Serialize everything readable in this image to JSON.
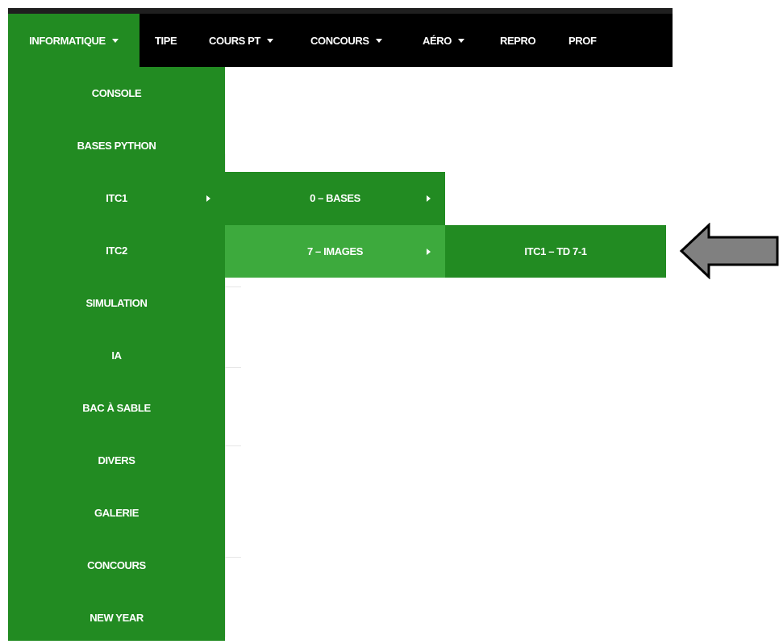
{
  "navbar": {
    "items": [
      {
        "label": "INFORMATIQUE",
        "dropdown": true
      },
      {
        "label": "TIPE",
        "dropdown": false
      },
      {
        "label": "COURS PT",
        "dropdown": true
      },
      {
        "label": "CONCOURS",
        "dropdown": true
      },
      {
        "label": "AÉRO",
        "dropdown": true
      },
      {
        "label": "REPRO",
        "dropdown": false
      },
      {
        "label": "PROF",
        "dropdown": false
      }
    ]
  },
  "menu_level1": {
    "items": [
      {
        "label": "CONSOLE"
      },
      {
        "label": "BASES PYTHON"
      },
      {
        "label": "ITC1",
        "submenu": true
      },
      {
        "label": "ITC2"
      },
      {
        "label": "SIMULATION"
      },
      {
        "label": "IA"
      },
      {
        "label": "BAC À SABLE"
      },
      {
        "label": "DIVERS"
      },
      {
        "label": "GALERIE"
      },
      {
        "label": "CONCOURS"
      },
      {
        "label": "NEW YEAR"
      }
    ]
  },
  "menu_level2": {
    "items": [
      {
        "label": "0 – BASES",
        "submenu": true
      },
      {
        "label": "7 – IMAGES",
        "submenu": true
      }
    ]
  },
  "menu_level3": {
    "items": [
      {
        "label": "ITC1 – TD 7-1"
      }
    ]
  },
  "annotation": {
    "icon": "left-arrow-icon",
    "fill": "#808080",
    "stroke": "#000000"
  },
  "colors": {
    "menu_green": "#228b22",
    "highlight_green": "#3daa3d",
    "navbar": "#000000"
  }
}
